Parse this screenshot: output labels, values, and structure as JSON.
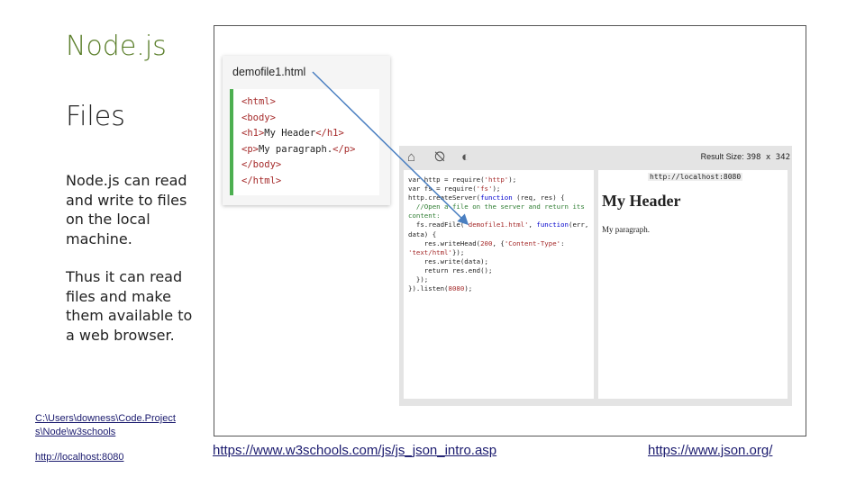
{
  "slide": {
    "title": "Node.js",
    "subtitle": "Files",
    "paragraph1": "Node.js can read and write to files on the local machine.",
    "paragraph2": "Thus it can read files and make them available to a web browser.",
    "path_link": "C:\\Users\\downess\\Code.Projects\\Node\\w3schools",
    "localhost_link": "http://localhost:8080",
    "w3_link": "https://www.w3schools.com/js/js_json_intro.asp",
    "json_link": "https://www.json.org/"
  },
  "file_card": {
    "filename": "demofile1.html",
    "lines": [
      {
        "text": "<html>"
      },
      {
        "text": "<body>"
      },
      {
        "text": "<h1>My Header</h1>"
      },
      {
        "text": "<p>My paragraph.</p>"
      },
      {
        "text": "</body>"
      },
      {
        "text": "</html>"
      }
    ]
  },
  "editor": {
    "result_size_label": "Result Size:",
    "result_size_value": "398 x 342",
    "result_url": "http://localhost:8080",
    "result_header": "My Header",
    "result_paragraph": "My paragraph.",
    "icons": [
      "home-icon",
      "rotate-icon",
      "contrast-icon"
    ]
  },
  "colors": {
    "title_green": "#5b7f2b",
    "arrow_blue": "#4a7fc1",
    "file_border_green": "#4caf50"
  }
}
